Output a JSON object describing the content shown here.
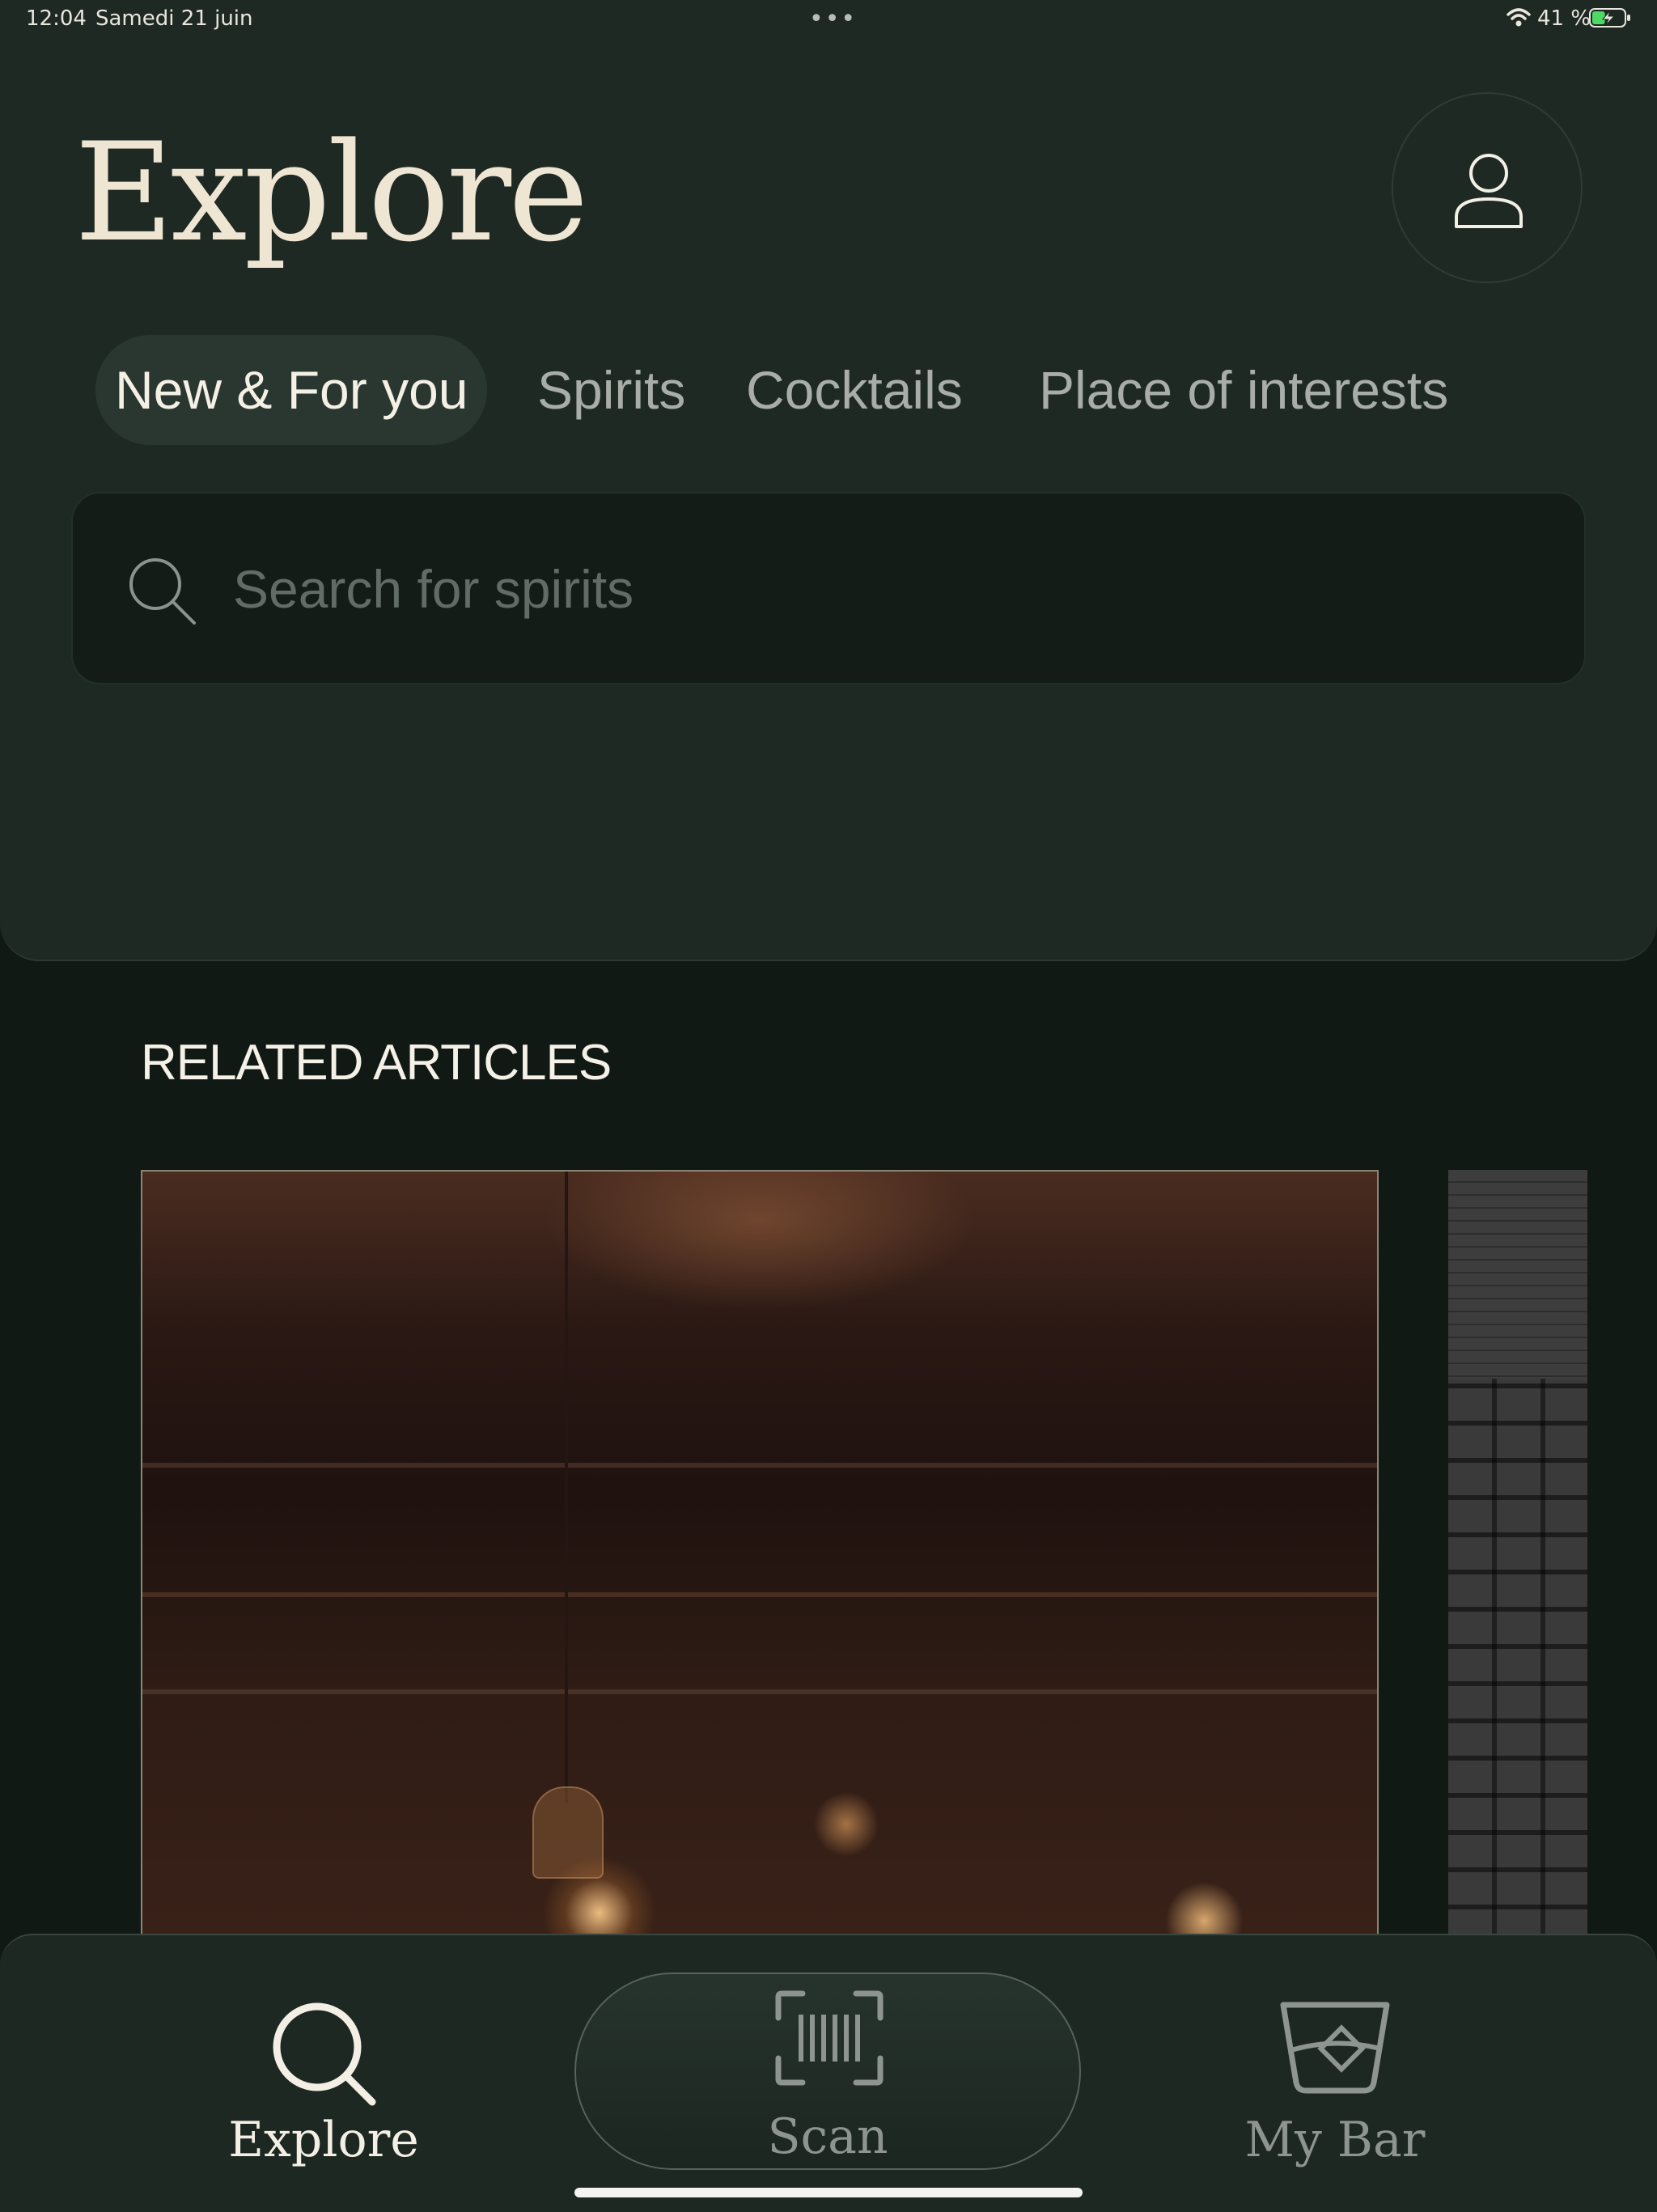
{
  "status_bar": {
    "time": "12:04",
    "date": "Samedi 21 juin",
    "battery_percent": "41 %",
    "battery_level": 0.41
  },
  "header": {
    "title": "Explore",
    "profile_icon": "person-icon"
  },
  "tabs": [
    {
      "label": "New & For you",
      "active": true
    },
    {
      "label": "Spirits",
      "active": false
    },
    {
      "label": "Cocktails",
      "active": false
    },
    {
      "label": "Place of interests",
      "active": false
    }
  ],
  "search": {
    "placeholder": "Search for spirits",
    "value": ""
  },
  "related": {
    "title": "RELATED ARTICLES"
  },
  "bottom_nav": {
    "items": [
      {
        "label": "Explore",
        "icon": "search-icon",
        "active": true
      },
      {
        "label": "Scan",
        "icon": "barcode-scan-icon",
        "active": false
      },
      {
        "label": "My Bar",
        "icon": "glass-icon",
        "active": false
      }
    ]
  },
  "colors": {
    "background": "#111915",
    "header_panel": "#1e2923",
    "title": "#eee5d2",
    "inactive_text": "#8e9590",
    "battery_charging": "#4cd964"
  }
}
